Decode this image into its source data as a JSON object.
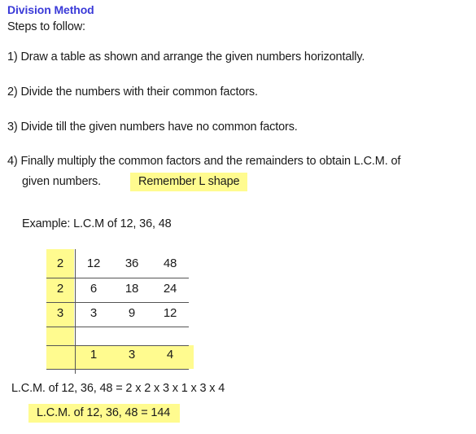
{
  "document": {
    "title": "Division Method",
    "title_color": "#3A3AD8",
    "highlight_color": "#FFFB8F",
    "steps_label": "Steps to follow:",
    "steps": [
      "1) Draw a table as shown and arrange the given numbers horizontally.",
      "2) Divide the numbers with their common factors.",
      "3) Divide till the given numbers have no common factors.",
      "4) Finally multiply the common factors and the remainders to obtain L.C.M. of",
      "given numbers."
    ],
    "remember_note": "Remember L shape",
    "example_label": "Example: L.C.M of 12, 36, 48",
    "division_table": {
      "divisors": [
        "2",
        "2",
        "3",
        ""
      ],
      "rows": [
        [
          "12",
          "36",
          "48"
        ],
        [
          "6",
          "18",
          "24"
        ],
        [
          "3",
          "9",
          "12"
        ],
        [
          "1",
          "3",
          "4"
        ]
      ]
    },
    "lcm_expression": "L.C.M. of 12, 36, 48  =  2 x 2 x 3 x 1 x 3 x 4",
    "lcm_result": "L.C.M.  of 12, 36, 48 = 144"
  }
}
